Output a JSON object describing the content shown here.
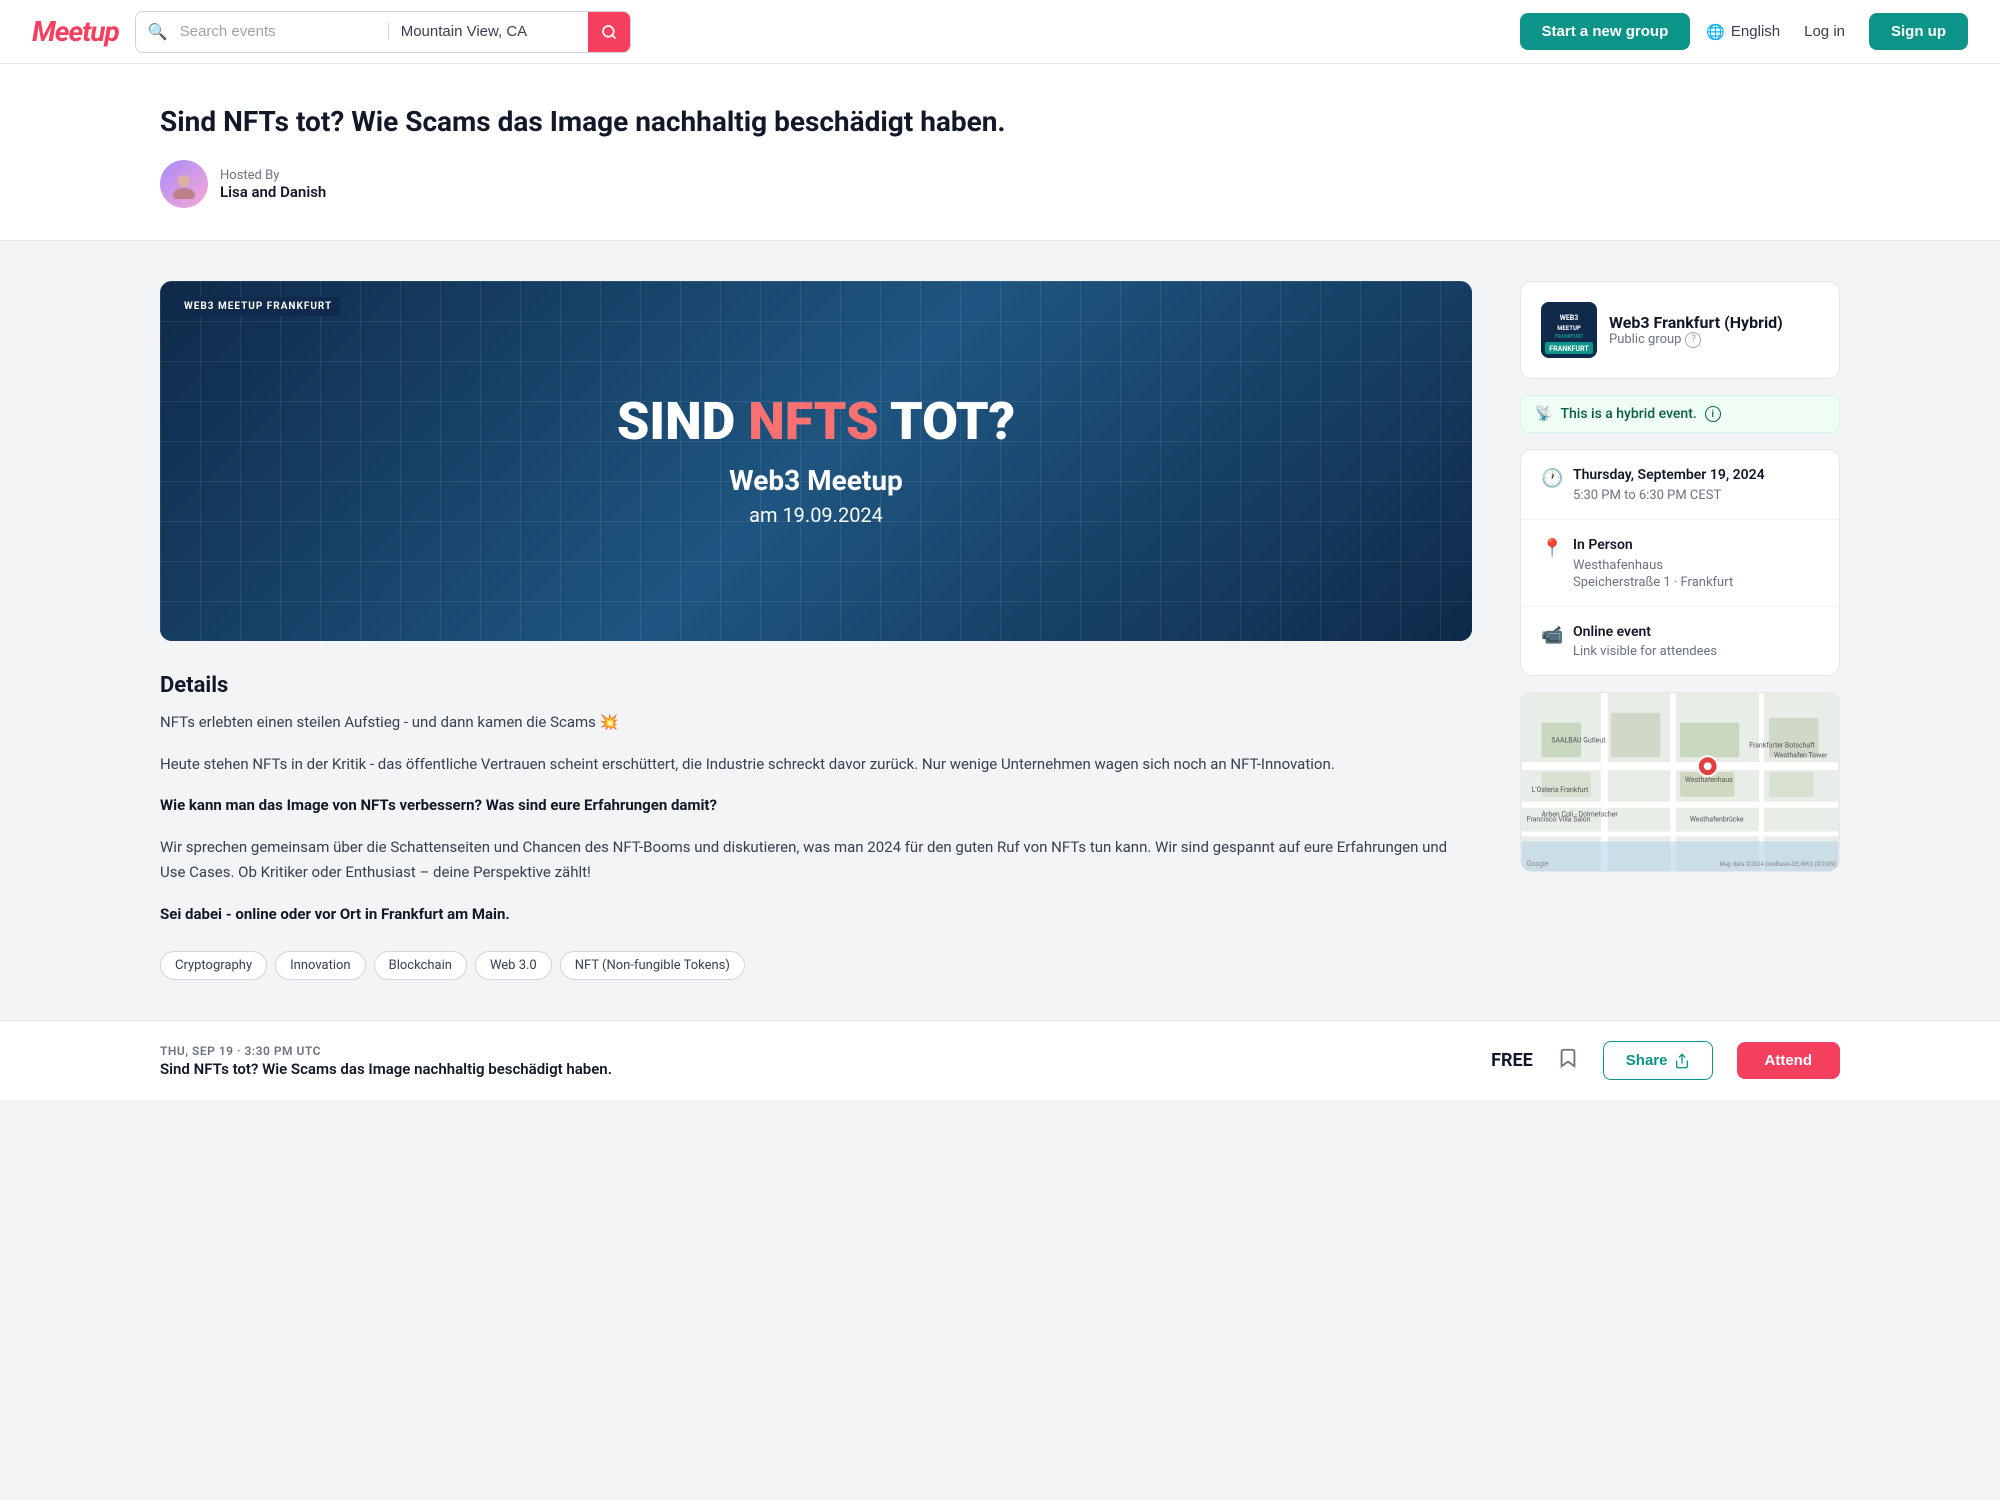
{
  "header": {
    "logo": "Meetup",
    "search_placeholder": "Search events",
    "location_value": "Mountain View, CA",
    "new_group_label": "Start a new group",
    "lang_label": "English",
    "login_label": "Log in",
    "signup_label": "Sign up"
  },
  "event": {
    "title": "Sind NFTs tot? Wie Scams das Image nachhaltig beschädigt haben.",
    "hosted_by_label": "Hosted By",
    "host_name": "Lisa and Danish",
    "image": {
      "badge": "WEB3 MEETUP FRANKFURT",
      "line1_white": "SIND",
      "line1_highlight": "NFTS",
      "line1_white2": "TOT?",
      "subtitle": "Web3 Meetup",
      "date_label": "am 19.09.2024"
    },
    "details_heading": "Details",
    "para1": "NFTs erlebten einen steilen Aufstieg - und dann kamen die Scams 💥",
    "para2": "Heute stehen NFTs in der Kritik - das öffentliche Vertrauen scheint erschüttert, die Industrie schreckt davor zurück. Nur wenige Unternehmen wagen sich noch an NFT-Innovation.",
    "bold_question": "Wie kann man das Image von NFTs verbessern? Was sind eure Erfahrungen damit?",
    "para3": "Wir sprechen gemeinsam über die Schattenseiten und Chancen des NFT-Booms und diskutieren, was man 2024 für den guten Ruf von NFTs tun kann. Wir sind gespannt auf eure Erfahrungen und Use Cases. Ob Kritiker oder Enthusiast – deine Perspektive zählt!",
    "bold_cta": "Sei dabei - online oder vor Ort in Frankfurt am Main.",
    "tags": [
      "Cryptography",
      "Innovation",
      "Blockchain",
      "Web 3.0",
      "NFT (Non-fungible Tokens)"
    ],
    "group": {
      "name": "Web3 Frankfurt (Hybrid)",
      "type": "Public group",
      "logo_text": "WEB3\nMEETUP\nFRANKFURT"
    },
    "hybrid_label": "This is a hybrid event.",
    "date_display": "Thursday, September 19, 2024",
    "time_display": "5:30 PM to 6:30 PM CEST",
    "location_type": "In Person",
    "venue_name": "Westhafenhaus",
    "venue_address": "Speicherstraße 1 · Frankfurt",
    "online_label": "Online event",
    "online_note": "Link visible for attendees"
  },
  "footer": {
    "date": "THU, SEP 19 · 3:30 PM UTC",
    "event_title": "Sind NFTs tot? Wie Scams das Image nachhaltig beschädigt haben.",
    "price": "FREE",
    "share_label": "Share",
    "attend_label": "Attend"
  }
}
